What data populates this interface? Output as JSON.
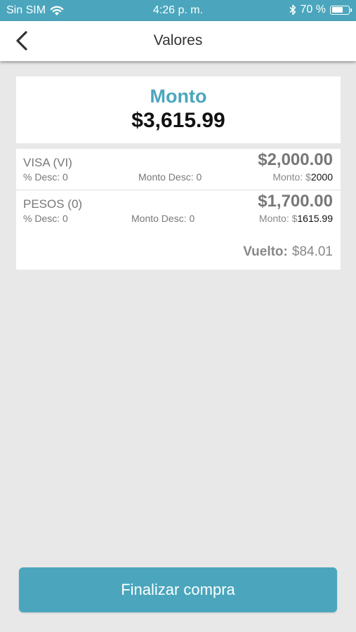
{
  "status_bar": {
    "carrier": "Sin SIM",
    "time": "4:26 p. m.",
    "battery_percent": "70 %",
    "battery_level": 0.7
  },
  "nav": {
    "title": "Valores"
  },
  "amount": {
    "label": "Monto",
    "value": "$3,615.99"
  },
  "payments": [
    {
      "name": "VISA (VI)",
      "amount": "$2,000.00",
      "pct_desc": "% Desc: 0",
      "monto_desc": "Monto Desc: 0",
      "monto_label": "Monto: $",
      "monto_value": "2000"
    },
    {
      "name": "PESOS (0)",
      "amount": "$1,700.00",
      "pct_desc": "% Desc: 0",
      "monto_desc": "Monto Desc: 0",
      "monto_label": "Monto: $",
      "monto_value": "1615.99"
    }
  ],
  "change": {
    "label": "Vuelto:",
    "value": "$84.01"
  },
  "finish_button": {
    "label": "Finalizar compra"
  },
  "colors": {
    "accent": "#4ba6bd",
    "background": "#e8e8e8"
  }
}
